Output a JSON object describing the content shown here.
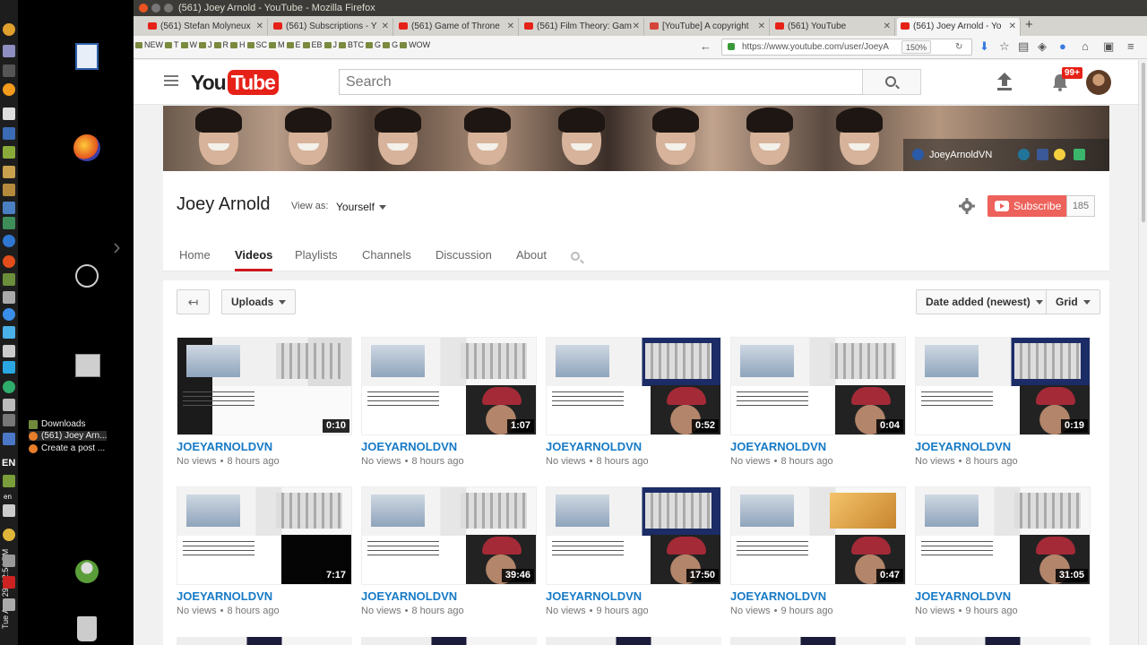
{
  "window": {
    "title": "(561) Joey Arnold - YouTube - Mozilla Firefox"
  },
  "tabs": [
    {
      "label": "(561) Stefan Molyneux"
    },
    {
      "label": "(561) Subscriptions - Y"
    },
    {
      "label": "(561) Game of Throne"
    },
    {
      "label": "(561) Film Theory: Gam"
    },
    {
      "label": "[YouTube] A copyright"
    },
    {
      "label": "(561) YouTube"
    },
    {
      "label": "(561) Joey Arnold - Yo"
    }
  ],
  "bookmarks": [
    "NEW",
    "T",
    "W",
    "J",
    "R",
    "H",
    "SC",
    "M",
    "E",
    "EB",
    "J",
    "BTC",
    "G",
    "G",
    "WOW"
  ],
  "urlbar": {
    "url": "https://www.youtube.com/user/JoeyA",
    "zoom": "150%"
  },
  "desktop": {
    "tray_items": [
      "Downloads",
      "(561) Joey Arn...",
      "Create a post ..."
    ],
    "language": "EN",
    "language_small": "en",
    "clock": "Tue Aug 29, 12:54 PM"
  },
  "youtube": {
    "logo_you": "You",
    "logo_tube": "Tube",
    "search_placeholder": "Search",
    "notification_count": "99+",
    "banner_channel": "JoeyArnoldVN",
    "channel_name": "Joey Arnold",
    "view_as_label": "View as:",
    "view_as_value": "Yourself",
    "subscribe_label": "Subscribe",
    "subscriber_count": "185",
    "channel_tabs": [
      "Home",
      "Videos",
      "Playlists",
      "Channels",
      "Discussion",
      "About"
    ],
    "active_tab": "Videos",
    "back_glyph": "↤",
    "uploads_label": "Uploads",
    "sort_label": "Date added (newest)",
    "view_mode_label": "Grid"
  },
  "videos": [
    {
      "title": "JOEYARNOLDVN",
      "views": "No views",
      "age": "8 hours ago",
      "duration": "0:10"
    },
    {
      "title": "JOEYARNOLDVN",
      "views": "No views",
      "age": "8 hours ago",
      "duration": "1:07"
    },
    {
      "title": "JOEYARNOLDVN",
      "views": "No views",
      "age": "8 hours ago",
      "duration": "0:52"
    },
    {
      "title": "JOEYARNOLDVN",
      "views": "No views",
      "age": "8 hours ago",
      "duration": "0:04"
    },
    {
      "title": "JOEYARNOLDVN",
      "views": "No views",
      "age": "8 hours ago",
      "duration": "0:19"
    },
    {
      "title": "JOEYARNOLDVN",
      "views": "No views",
      "age": "8 hours ago",
      "duration": "7:17"
    },
    {
      "title": "JOEYARNOLDVN",
      "views": "No views",
      "age": "8 hours ago",
      "duration": "39:46"
    },
    {
      "title": "JOEYARNOLDVN",
      "views": "No views",
      "age": "9 hours ago",
      "duration": "17:50"
    },
    {
      "title": "JOEYARNOLDVN",
      "views": "No views",
      "age": "9 hours ago",
      "duration": "0:47"
    },
    {
      "title": "JOEYARNOLDVN",
      "views": "No views",
      "age": "9 hours ago",
      "duration": "31:05"
    }
  ],
  "colors": {
    "youtube_red": "#e62117",
    "link_blue": "#167ac6"
  }
}
